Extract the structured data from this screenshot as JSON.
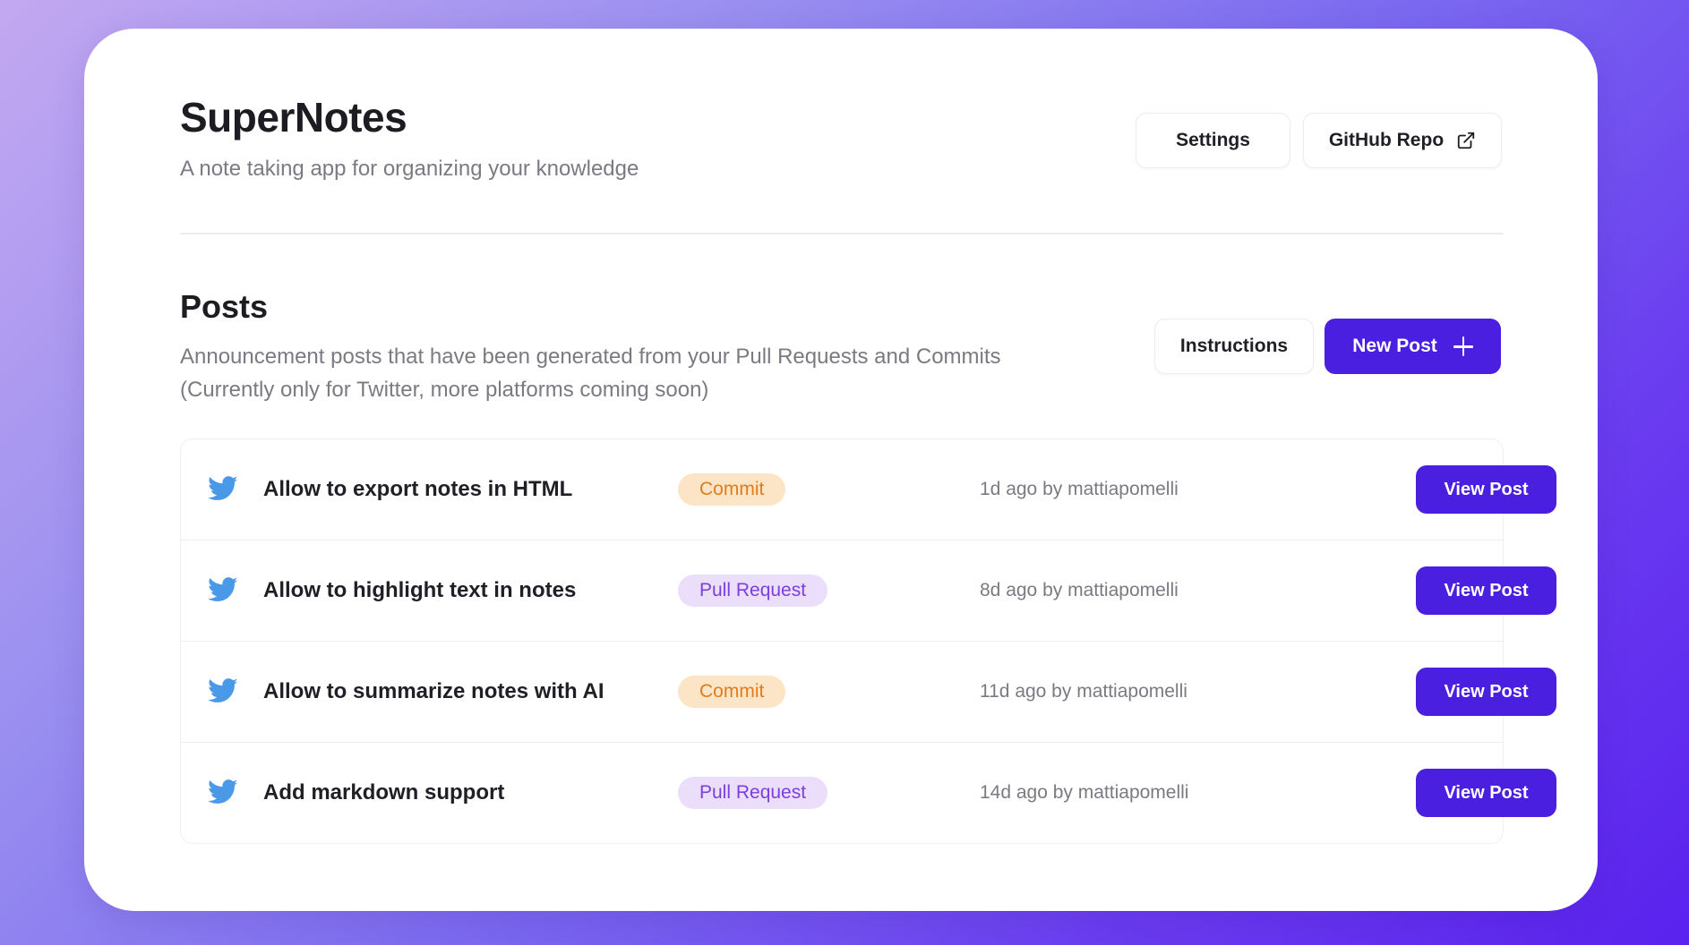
{
  "app": {
    "title": "SuperNotes",
    "subtitle": "A note taking app for organizing your knowledge"
  },
  "header": {
    "settings_label": "Settings",
    "github_label": "GitHub Repo",
    "github_icon": "external-link-icon"
  },
  "posts_section": {
    "title": "Posts",
    "description": "Announcement posts that have been generated from your Pull Requests and Commits (Currently only for Twitter, more platforms coming soon)",
    "instructions_label": "Instructions",
    "new_post_label": "New Post",
    "new_post_icon": "plus-icon"
  },
  "posts": [
    {
      "platform_icon": "twitter-icon",
      "title": "Allow to export notes in HTML",
      "type": "Commit",
      "meta": "1d ago by mattiapomelli",
      "action": "View Post"
    },
    {
      "platform_icon": "twitter-icon",
      "title": "Allow to highlight text in notes",
      "type": "Pull Request",
      "meta": "8d ago by mattiapomelli",
      "action": "View Post"
    },
    {
      "platform_icon": "twitter-icon",
      "title": "Allow to summarize notes with AI",
      "type": "Commit",
      "meta": "11d ago by mattiapomelli",
      "action": "View Post"
    },
    {
      "platform_icon": "twitter-icon",
      "title": "Add markdown support",
      "type": "Pull Request",
      "meta": "14d ago by mattiapomelli",
      "action": "View Post"
    }
  ],
  "colors": {
    "accent": "#4a1fe0",
    "twitter": "#4a99e9",
    "commit_badge_bg": "#fbe5c6",
    "commit_badge_text": "#e07c1c",
    "pr_badge_bg": "#ebdefb",
    "pr_badge_text": "#7b3fdc"
  }
}
